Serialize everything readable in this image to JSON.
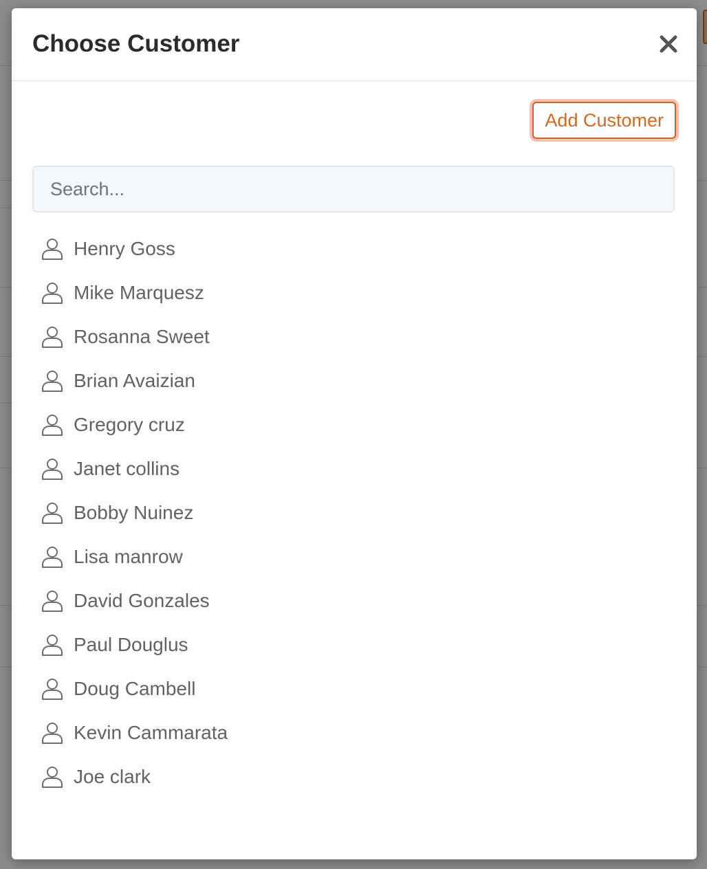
{
  "modal": {
    "title": "Choose Customer",
    "close_label": "×"
  },
  "toolbar": {
    "add_customer_label": "Add Customer"
  },
  "search": {
    "placeholder": "Search...",
    "value": ""
  },
  "customers": [
    {
      "name": "Henry Goss",
      "icon": "user-icon"
    },
    {
      "name": "Mike Marquesz",
      "icon": "user-icon"
    },
    {
      "name": "Rosanna Sweet",
      "icon": "user-icon"
    },
    {
      "name": "Brian Avaizian",
      "icon": "user-icon"
    },
    {
      "name": "Gregory cruz",
      "icon": "user-icon"
    },
    {
      "name": "Janet collins",
      "icon": "user-icon"
    },
    {
      "name": "Bobby Nuinez",
      "icon": "user-icon"
    },
    {
      "name": "Lisa manrow",
      "icon": "user-icon"
    },
    {
      "name": "David Gonzales",
      "icon": "user-icon"
    },
    {
      "name": "Paul Douglus",
      "icon": "user-icon"
    },
    {
      "name": "Doug Cambell",
      "icon": "user-icon"
    },
    {
      "name": "Kevin Cammarata",
      "icon": "user-icon"
    },
    {
      "name": "Joe clark",
      "icon": "user-icon"
    }
  ],
  "colors": {
    "accent": "#d2691e",
    "title": "#2b2b2b",
    "list_text": "#5f6368",
    "overlay": "#8d8d8d"
  }
}
